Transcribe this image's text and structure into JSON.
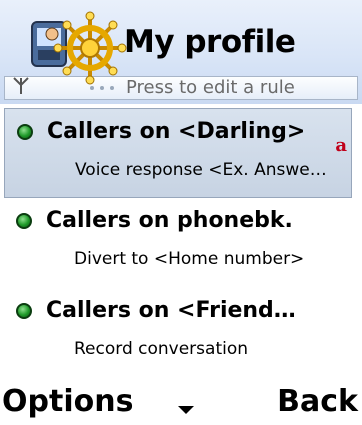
{
  "header": {
    "title": "My profile",
    "info_text": "Press to edit a rule",
    "logo_icon": "profile-wheel-icon",
    "signal_icon": "signal-antenna-icon"
  },
  "rules": [
    {
      "title": "Callers on <Darling>",
      "subtitle": "Voice response <Ex. Answe…",
      "selected": true,
      "status": "active"
    },
    {
      "title": "Callers on phonebk.",
      "subtitle": "Divert to <Home number>",
      "selected": false,
      "status": "active"
    },
    {
      "title": "Callers on <Friend…",
      "subtitle": "Record conversation",
      "selected": false,
      "status": "active"
    }
  ],
  "selected_marker": "a",
  "softkeys": {
    "left": "Options",
    "right": "Back",
    "middle_icon": "chevron-down-icon"
  },
  "colors": {
    "status_active": "#1f9a2a",
    "marker": "#c0001a",
    "header_bg": "#d9e5f7",
    "selection_bg": "#c7d3e3"
  }
}
